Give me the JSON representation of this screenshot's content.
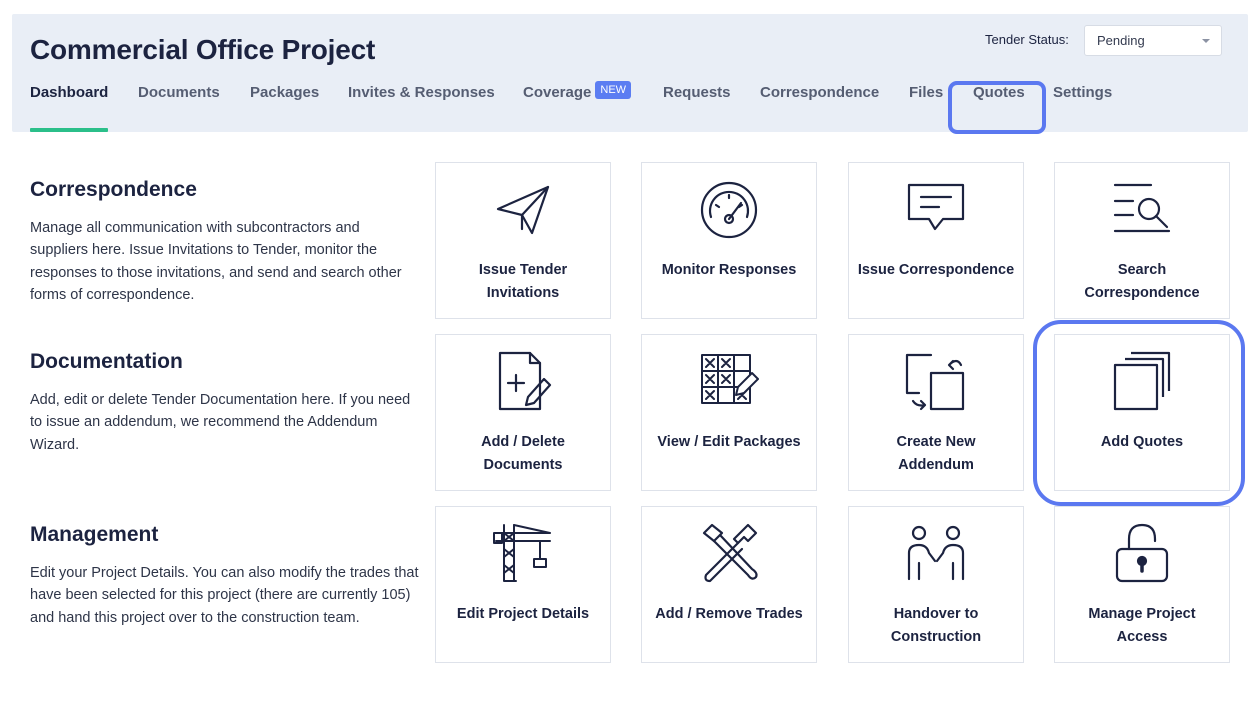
{
  "project": {
    "title": "Commercial Office Project"
  },
  "tender": {
    "label": "Tender Status:",
    "value": "Pending"
  },
  "tabs": [
    {
      "label": "Dashboard"
    },
    {
      "label": "Documents"
    },
    {
      "label": "Packages"
    },
    {
      "label": "Invites & Responses"
    },
    {
      "label": "Coverage",
      "badge": "NEW"
    },
    {
      "label": "Requests"
    },
    {
      "label": "Correspondence"
    },
    {
      "label": "Files"
    },
    {
      "label": "Quotes"
    },
    {
      "label": "Settings"
    }
  ],
  "active_tab": "Dashboard",
  "highlighted_tab": "Quotes",
  "sections": [
    {
      "title": "Correspondence",
      "body": "Manage all communication with subcontractors and suppliers here. Issue Invitations to Tender, monitor the responses to those invitations, and send and search other forms of correspondence."
    },
    {
      "title": "Documentation",
      "body": "Add, edit or delete Tender Documentation here. If you need to issue an addendum, we recommend the Addendum Wizard."
    },
    {
      "title": "Management",
      "body": "Edit your Project Details. You can also modify the trades that have been selected for this project (there are currently 105) and hand this project over to the construction team."
    }
  ],
  "tiles": [
    {
      "label": "Issue Tender Invitations",
      "icon": "paper-plane-icon"
    },
    {
      "label": "Monitor Responses",
      "icon": "gauge-icon"
    },
    {
      "label": "Issue Correspondence",
      "icon": "message-icon"
    },
    {
      "label": "Search Correspondence",
      "icon": "search-list-icon"
    },
    {
      "label": "Add / Delete Documents",
      "icon": "document-add-icon"
    },
    {
      "label": "View / Edit Packages",
      "icon": "grid-edit-icon"
    },
    {
      "label": "Create New Addendum",
      "icon": "addendum-icon"
    },
    {
      "label": "Add Quotes",
      "icon": "stacked-pages-icon"
    },
    {
      "label": "Edit Project Details",
      "icon": "crane-icon"
    },
    {
      "label": "Add / Remove Trades",
      "icon": "tools-icon"
    },
    {
      "label": "Handover to Construction",
      "icon": "people-icon"
    },
    {
      "label": "Manage Project Access",
      "icon": "unlock-icon"
    }
  ],
  "highlighted_tile": "Add Quotes",
  "colors": {
    "accent_green": "#2bbf8a",
    "highlight_blue": "#5b78f0",
    "badge_blue": "#5b7df2",
    "header_bg": "#e9eef6",
    "text_dark": "#1c2340"
  }
}
